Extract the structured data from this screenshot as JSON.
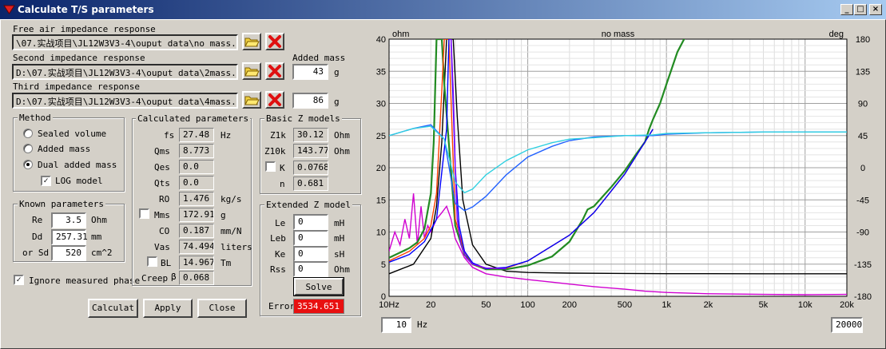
{
  "window": {
    "title": "Calculate T/S parameters",
    "minimize": "_",
    "maximize": "□",
    "close": "×"
  },
  "files": {
    "free_label": "Free air impedance response",
    "free_path": "\\07.实战项目\\JL12W3V3-4\\ouput data\\no mass.txt",
    "second_label": "Second impedance response",
    "second_path": "D:\\07.实战项目\\JL12W3V3-4\\ouput data\\2mass.txt",
    "third_label": "Third impedance response",
    "third_path": "D:\\07.实战项目\\JL12W3V3-4\\ouput data\\4mass.txt",
    "added_mass_label": "Added mass",
    "mass2": "43",
    "mass3": "86",
    "unit_g": "g"
  },
  "method": {
    "title": "Method",
    "sealed": "Sealed volume",
    "added": "Added mass",
    "dual": "Dual added mass",
    "log": "LOG model",
    "selected": "dual",
    "log_checked": true
  },
  "known": {
    "title": "Known parameters",
    "re_label": "Re",
    "re": "3.5",
    "re_unit": "Ohm",
    "dd_label": "Dd",
    "dd": "257.31",
    "dd_unit": "mm",
    "sd_label": "or Sd",
    "sd": "520",
    "sd_unit": "cm^2"
  },
  "ignore_phase": {
    "label": "Ignore measured phase",
    "checked": true
  },
  "calc": {
    "title": "Calculated parameters",
    "fs_l": "fs",
    "fs": "27.48",
    "fs_u": "Hz",
    "qms_l": "Qms",
    "qms": "8.773",
    "qes_l": "Qes",
    "qes": "0.0",
    "qts_l": "Qts",
    "qts": "0.0",
    "ro_l": "RO",
    "ro": "1.476",
    "ro_u": "kg/s",
    "mms_l": "Mms",
    "mms": "172.91",
    "mms_u": "g",
    "co_l": "CO",
    "co": "0.187",
    "co_u": "mm/N",
    "vas_l": "Vas",
    "vas": "74.4947",
    "vas_u": "liters",
    "bl_l": "BL",
    "bl": "14.967",
    "bl_u": "Tm",
    "creep_l": "Creep",
    "beta": "β",
    "creep": "0.068"
  },
  "basic": {
    "title": "Basic Z models",
    "z1k_l": "Z1k",
    "z1k": "30.12",
    "z1k_u": "Ohm",
    "z10k_l": "Z10k",
    "z10k": "143.77",
    "z10k_u": "Ohm",
    "k_l": "K",
    "k": "0.07682",
    "n_l": "n",
    "n": "0.681"
  },
  "extended": {
    "title": "Extended Z model",
    "le_l": "Le",
    "le": "0",
    "le_u": "mH",
    "leb_l": "Leb",
    "leb": "0",
    "leb_u": "mH",
    "ke_l": "Ke",
    "ke": "0",
    "ke_u": "sH",
    "rss_l": "Rss",
    "rss": "0",
    "rss_u": "Ohm",
    "solve": "Solve",
    "error_l": "Error",
    "error": "3534.651"
  },
  "buttons": {
    "calculate": "Calculat",
    "apply": "Apply",
    "close": "Close"
  },
  "plot": {
    "fmin": "10",
    "fmin_unit": "Hz",
    "fmax": "20000"
  },
  "chart_data": {
    "type": "line",
    "title": "no mass",
    "ylabel": "ohm",
    "y2label": "deg",
    "xscale": "log",
    "xlim": [
      10,
      20000
    ],
    "ylim": [
      0,
      40
    ],
    "y2lim": [
      -180,
      180
    ],
    "xticks": [
      "10Hz",
      "20",
      "50",
      "100",
      "200",
      "500",
      "1k",
      "2k",
      "5k",
      "10k",
      "20k"
    ],
    "xtick_vals": [
      10,
      20,
      50,
      100,
      200,
      500,
      1000,
      2000,
      5000,
      10000,
      20000
    ],
    "yticks": [
      "0",
      "5",
      "10",
      "15",
      "20",
      "25",
      "30",
      "35",
      "40"
    ],
    "y2ticks": [
      "-180",
      "-135",
      "-90",
      "-45",
      "0",
      "45",
      "90",
      "135",
      "180"
    ],
    "grid": true,
    "series": [
      {
        "color": "#d000d0",
        "x": [
          10,
          11,
          12,
          13,
          14,
          15,
          16,
          17,
          18,
          19,
          20,
          22,
          24,
          26,
          28,
          30,
          35,
          40,
          50,
          70,
          100,
          150,
          200,
          300,
          500,
          700,
          1000,
          2000,
          5000,
          10000,
          20000
        ],
        "y": [
          7,
          10,
          8,
          12,
          9,
          16,
          8,
          14,
          9,
          11,
          10,
          12,
          13,
          14,
          12,
          9,
          6,
          4.5,
          3.5,
          3,
          2.6,
          2.2,
          1.9,
          1.5,
          1.1,
          0.8,
          0.6,
          0.4,
          0.3,
          0.25,
          0.3
        ]
      },
      {
        "color": "#000000",
        "x": [
          10,
          15,
          20,
          22,
          24,
          26,
          27.5,
          29,
          31,
          34,
          40,
          50,
          70,
          100,
          200,
          500,
          1000,
          2000,
          5000,
          10000,
          20000
        ],
        "y": [
          3.5,
          5,
          9,
          14,
          24,
          40,
          40,
          40,
          28,
          15,
          8,
          5,
          3.9,
          3.7,
          3.6,
          3.55,
          3.52,
          3.51,
          3.5,
          3.5,
          3.5
        ]
      },
      {
        "color": "#228b22",
        "x": [
          10,
          12,
          14,
          16,
          18,
          20,
          21,
          22,
          23,
          24,
          25,
          30,
          35,
          40,
          50,
          70,
          100,
          150,
          200,
          250,
          270,
          300,
          400,
          500,
          600,
          700,
          750,
          800,
          900,
          1000,
          1200,
          1500
        ],
        "y": [
          6,
          6.8,
          7.5,
          8.4,
          10.5,
          16,
          24,
          40,
          40,
          40,
          33,
          11,
          6.5,
          5,
          4.2,
          4.2,
          4.8,
          6.2,
          8.5,
          12,
          13.5,
          14,
          17,
          19.5,
          22,
          24,
          26,
          27.5,
          30,
          33,
          38,
          42
        ]
      },
      {
        "color": "#ff4000",
        "x": [
          10,
          14,
          18,
          20,
          22,
          24,
          25,
          27,
          30,
          35,
          40,
          50,
          70,
          100,
          200,
          300,
          500,
          800
        ],
        "y": [
          5.5,
          7,
          9,
          11,
          16,
          32,
          40,
          40,
          12,
          7,
          5,
          4.3,
          4.4,
          5.5,
          9.5,
          13,
          19,
          26
        ]
      },
      {
        "color": "#0000ff",
        "x": [
          10,
          14,
          18,
          22,
          26,
          27,
          28,
          30,
          32,
          35,
          40,
          50,
          70,
          100,
          200,
          300,
          500,
          800
        ],
        "y": [
          5.3,
          6.5,
          8.5,
          12,
          26,
          40,
          40,
          20,
          11,
          7,
          5.2,
          4.3,
          4.5,
          5.5,
          9.5,
          13,
          19,
          26
        ]
      },
      {
        "color": "#8000ff",
        "x": [
          27,
          28,
          29,
          30,
          31,
          33,
          36,
          40,
          50,
          70
        ],
        "y": [
          40,
          40,
          32,
          20,
          12,
          8,
          6,
          5,
          4.4,
          4.3
        ]
      },
      {
        "color": "#2060ff",
        "x": [
          10,
          15,
          20,
          25,
          30,
          35,
          40,
          50,
          70,
          100,
          150,
          200,
          300,
          500,
          800,
          1000,
          2000,
          5000,
          10000,
          20000
        ],
        "y2": [
          45,
          55,
          60,
          40,
          -50,
          -60,
          -55,
          -40,
          -10,
          15,
          30,
          38,
          43,
          45,
          45,
          47,
          49,
          50,
          50,
          50
        ]
      },
      {
        "color": "#30d0e0",
        "x": [
          10,
          15,
          20,
          25,
          30,
          35,
          40,
          50,
          70,
          100,
          150,
          200,
          300,
          500,
          800,
          1000,
          2000,
          5000,
          10000,
          20000
        ],
        "y2": [
          45,
          55,
          58,
          40,
          -20,
          -35,
          -30,
          -10,
          10,
          25,
          35,
          40,
          42,
          45,
          46,
          48,
          49,
          50,
          50,
          50
        ]
      }
    ]
  }
}
